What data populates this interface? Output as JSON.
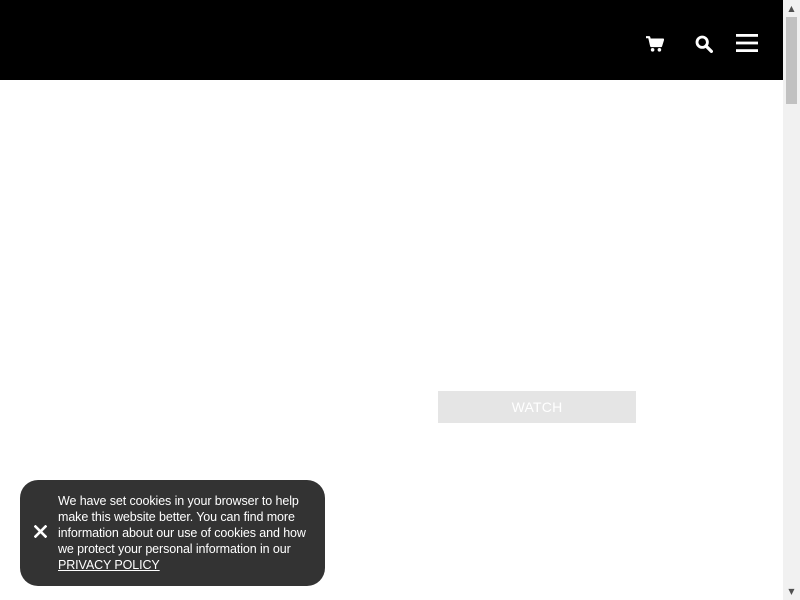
{
  "header": {
    "background_color": "#000000",
    "icons": {
      "cart": "cart-icon",
      "search": "search-icon",
      "menu": "hamburger-menu-icon"
    }
  },
  "main": {
    "watch_button_label": "WATCH",
    "watch_button_color": "#e5e5e5"
  },
  "cookie_banner": {
    "text": "We have set cookies in your browser to help make this website better. You can find more information about our use of cookies and how we protect your personal information in our ",
    "link_label": "PRIVACY POLICY",
    "close_icon": "close-icon",
    "background_color": "#333333"
  },
  "scrollbar": {
    "up_arrow": "▲",
    "down_arrow": "▼"
  }
}
